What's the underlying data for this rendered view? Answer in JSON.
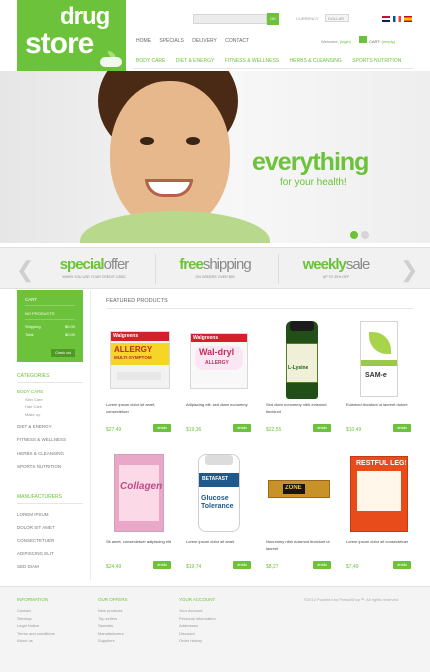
{
  "header": {
    "logo_word1": "drug",
    "logo_word2": "store",
    "logo_tagline": "for your health",
    "search_button": "OK",
    "currency_label": "CURRENCY",
    "currency_value": "DOLLAR",
    "flags": [
      "flag-en",
      "flag-fr",
      "flag-es"
    ],
    "nav": [
      "HOME",
      "SPECIALS",
      "DELIVERY",
      "CONTACT"
    ],
    "welcome_text": "Welcome,",
    "login_link": "(login)",
    "cart_label": "CART:",
    "cart_state": "(empty)"
  },
  "categories_nav": [
    "BODY CARE",
    "DIET & ENERGY",
    "FITNESS & WELLNESS",
    "HERBS & CLEANSING",
    "SPORTS NUTRITION"
  ],
  "slider": {
    "headline": "everything",
    "subline": "for your health!",
    "dots_total": 2,
    "dot_active": 1
  },
  "promos": [
    {
      "bold": "special",
      "rest": "offer",
      "small": "WHEN YOU USE YOUR CREDIT CARD"
    },
    {
      "bold": "free",
      "rest": "shipping",
      "small": "ON ORDERS OVER $99"
    },
    {
      "bold": "weekly",
      "rest": "sale",
      "small": "UP TO 30% OFF"
    }
  ],
  "cart_block": {
    "title": "CART",
    "empty_text": "NO PRODUCTS",
    "shipping_label": "Shipping",
    "shipping_value": "$0.00",
    "total_label": "Total",
    "total_value": "$0.00",
    "checkout_label": "Check out"
  },
  "sidebar": {
    "categories_title": "CATEGORIES",
    "items": [
      {
        "label": "BODY CARE",
        "type": "top-active"
      },
      {
        "label": "Skin Care",
        "type": "sub"
      },
      {
        "label": "Hair Care",
        "type": "sub"
      },
      {
        "label": "Make up",
        "type": "sub"
      },
      {
        "label": "DIET & ENERGY",
        "type": "top"
      },
      {
        "label": "FITNESS & WELLNESS",
        "type": "top"
      },
      {
        "label": "HERBS & CLEANSING",
        "type": "top"
      },
      {
        "label": "SPORTS NUTRITION",
        "type": "top"
      }
    ],
    "manufacturers_title": "MANUFACTURERS",
    "manufacturers": [
      "LOREM IPSUM",
      "DOLOR SIT AMET",
      "CONSECTETUER",
      "ADIPISCING ELIT",
      "SED DIAM"
    ]
  },
  "featured": {
    "title": "FEATURED PRODUCTS",
    "details_label": "details",
    "products": [
      {
        "name": "Lorem ipsum dolor sit amet, consectetuer",
        "price": "$27,49",
        "img_text": "ALLERGY",
        "img_sub": "MULTI-SYMPTOM",
        "brand": "Walgreens"
      },
      {
        "name": "Adipiscing elit, sed diam nonummy",
        "price": "$19,36",
        "img_text": "Wal-dryl",
        "img_sub": "ALLERGY",
        "brand": "Walgreens"
      },
      {
        "name": "Sed diam nonummy nibh euismod tincidunt",
        "price": "$22,55",
        "img_text": "L-Lysine",
        "img_sub": "",
        "brand": ""
      },
      {
        "name": "Euismod tincidunt ut laoreet dolore",
        "price": "$10,49",
        "img_text": "SAM-e",
        "img_sub": "",
        "brand": ""
      },
      {
        "name": "Sit amet, consectetuer adipiscing elit",
        "price": "$24,49",
        "img_text": "Collagen",
        "img_sub": "",
        "brand": ""
      },
      {
        "name": "Lorem ipsum dolor sit amet",
        "price": "$19,74",
        "img_text": "Glucose Tolerance",
        "img_sub": "",
        "brand": "BETAFAST"
      },
      {
        "name": "Nonummy nibh euismod tincidunt ut laoreet",
        "price": "$8,27",
        "img_text": "ZONE",
        "img_sub": "",
        "brand": ""
      },
      {
        "name": "Lorem ipsum dolor sit consectetuer",
        "price": "$7,49",
        "img_text": "RESTFUL LEGS",
        "img_sub": "",
        "brand": ""
      }
    ]
  },
  "footer": {
    "columns": [
      {
        "title": "INFORMATION",
        "items": [
          "Contact",
          "Sitemap",
          "Legal Notice",
          "Terms and conditions",
          "About us"
        ]
      },
      {
        "title": "OUR OFFERS",
        "items": [
          "New products",
          "Top sellers",
          "Specials",
          "Manufacturers",
          "Suppliers"
        ]
      },
      {
        "title": "YOUR ACCOUNT",
        "items": [
          "Your Account",
          "Personal information",
          "Addresses",
          "Discount",
          "Order history"
        ]
      }
    ],
    "copyright": "©2012 Powered by PrestaShop™. All rights reserved"
  },
  "colors": {
    "accent": "#6cc23a",
    "dark_accent": "#4f9a25"
  }
}
